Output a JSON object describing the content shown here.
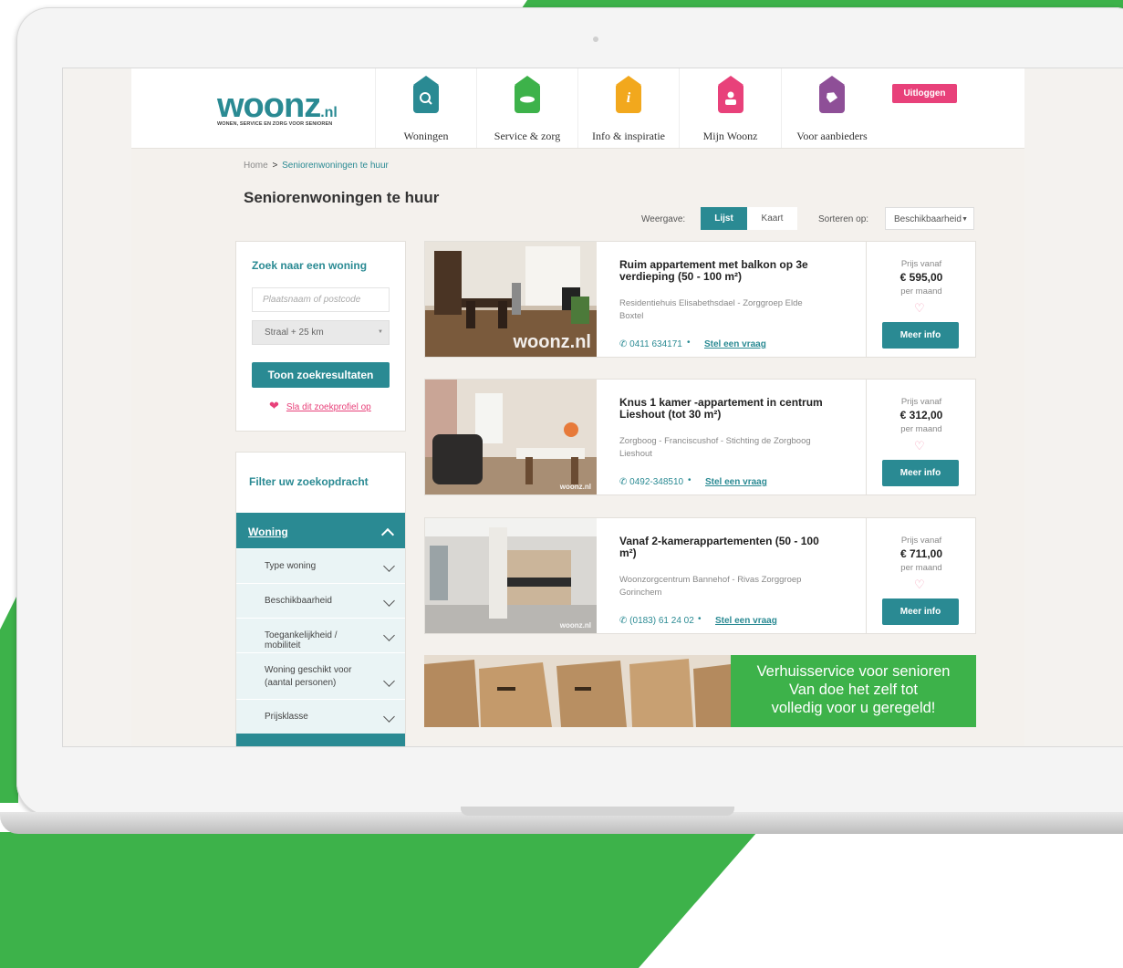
{
  "brand": {
    "logo": "woonz",
    "logo_suffix": ".nl",
    "tagline": "WONEN, SERVICE EN ZORG VOOR SENIOREN",
    "primary_color": "#2a8a93",
    "accent_color": "#e8417a",
    "green_color": "#3db24a"
  },
  "nav": [
    {
      "label": "Woningen",
      "icon": "search-icon",
      "color": "#2a8a93"
    },
    {
      "label": "Service & zorg",
      "icon": "hand-icon",
      "color": "#3db24a"
    },
    {
      "label": "Info & inspiratie",
      "icon": "info-icon",
      "color": "#f2a81d"
    },
    {
      "label": "Mijn Woonz",
      "icon": "user-icon",
      "color": "#e8417a"
    },
    {
      "label": "Voor aanbieders",
      "icon": "tag-icon",
      "color": "#8e4f97"
    }
  ],
  "logout_label": "Uitloggen",
  "breadcrumb": {
    "home": "Home",
    "separator": ">",
    "current": "Seniorenwoningen te huur"
  },
  "page_title": "Seniorenwoningen te huur",
  "view": {
    "label": "Weergave:",
    "options": [
      "Lijst",
      "Kaart"
    ],
    "active": "Lijst"
  },
  "sort": {
    "label": "Sorteren op:",
    "value": "Beschikbaarheid"
  },
  "search": {
    "title": "Zoek naar een woning",
    "placeholder": "Plaatsnaam of postcode",
    "radius": "Straal + 25 km",
    "button": "Toon zoekresultaten",
    "save": "Sla dit zoekprofiel op"
  },
  "filter": {
    "title": "Filter uw zoekopdracht",
    "section": "Woning",
    "items": [
      "Type woning",
      "Beschikbaarheid",
      "Toegankelijkheid / mobiliteit",
      "Woning geschikt voor (aantal personen)",
      "Prijsklasse"
    ]
  },
  "listings": [
    {
      "title": "Ruim appartement met balkon op 3e verdieping (50 - 100 m²)",
      "org": "Residentiehuis Elisabethsdael - Zorggroep Elde",
      "city": "Boxtel",
      "phone": "0411 634171",
      "ask": "Stel een vraag",
      "price_label": "Prijs vanaf",
      "price": "€ 595,00",
      "period": "per maand",
      "button": "Meer info",
      "watermark": "woonz.nl"
    },
    {
      "title": "Knus 1 kamer -appartement in centrum Lieshout (tot 30 m²)",
      "org": "Zorgboog - Franciscushof - Stichting de Zorgboog",
      "city": "Lieshout",
      "phone": "0492-348510",
      "ask": "Stel een vraag",
      "price_label": "Prijs vanaf",
      "price": "€ 312,00",
      "period": "per maand",
      "button": "Meer info",
      "watermark": "woonz.nl"
    },
    {
      "title": "Vanaf 2-kamerappartementen (50 - 100 m²)",
      "org": "Woonzorgcentrum Bannehof - Rivas Zorggroep",
      "city": "Gorinchem",
      "phone": "(0183) 61 24 02",
      "ask": "Stel een vraag",
      "price_label": "Prijs vanaf",
      "price": "€ 711,00",
      "period": "per maand",
      "button": "Meer info",
      "watermark": "woonz.nl"
    }
  ],
  "banner": {
    "line1": "Verhuisservice voor senioren",
    "line2": "Van doe het zelf tot",
    "line3": "volledig voor u geregeld!"
  }
}
